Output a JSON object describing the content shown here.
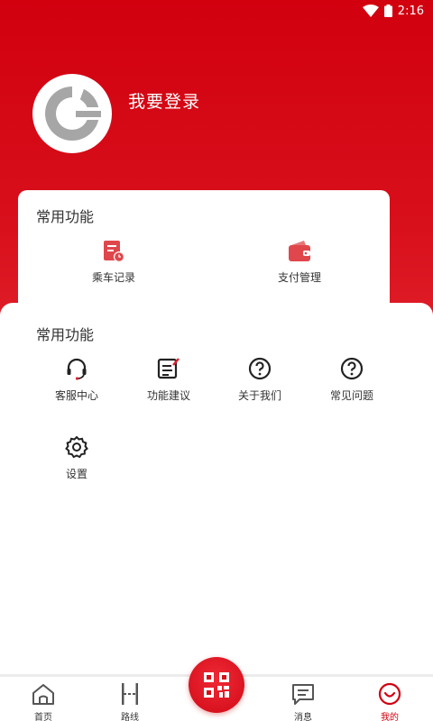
{
  "status_bar": {
    "time": "2:16"
  },
  "profile": {
    "login_label": "我要登录"
  },
  "card_common": {
    "title": "常用功能",
    "items": [
      {
        "label": "乘车记录",
        "icon": "ride-record-icon"
      },
      {
        "label": "支付管理",
        "icon": "wallet-icon"
      }
    ]
  },
  "card_more": {
    "title": "常用功能",
    "items": [
      {
        "label": "客服中心",
        "icon": "headset-icon"
      },
      {
        "label": "功能建议",
        "icon": "edit-note-icon"
      },
      {
        "label": "关于我们",
        "icon": "question-icon"
      },
      {
        "label": "常见问题",
        "icon": "question-icon"
      },
      {
        "label": "设置",
        "icon": "gear-icon"
      }
    ]
  },
  "tabbar": {
    "items": [
      {
        "label": "首页",
        "icon": "home-icon"
      },
      {
        "label": "路线",
        "icon": "route-icon"
      },
      {
        "label": "消息",
        "icon": "message-icon"
      },
      {
        "label": "我的",
        "icon": "smile-icon"
      }
    ],
    "active": "我的"
  },
  "colors": {
    "brand": "#d2000f",
    "icon_accent": "#e0474c"
  }
}
